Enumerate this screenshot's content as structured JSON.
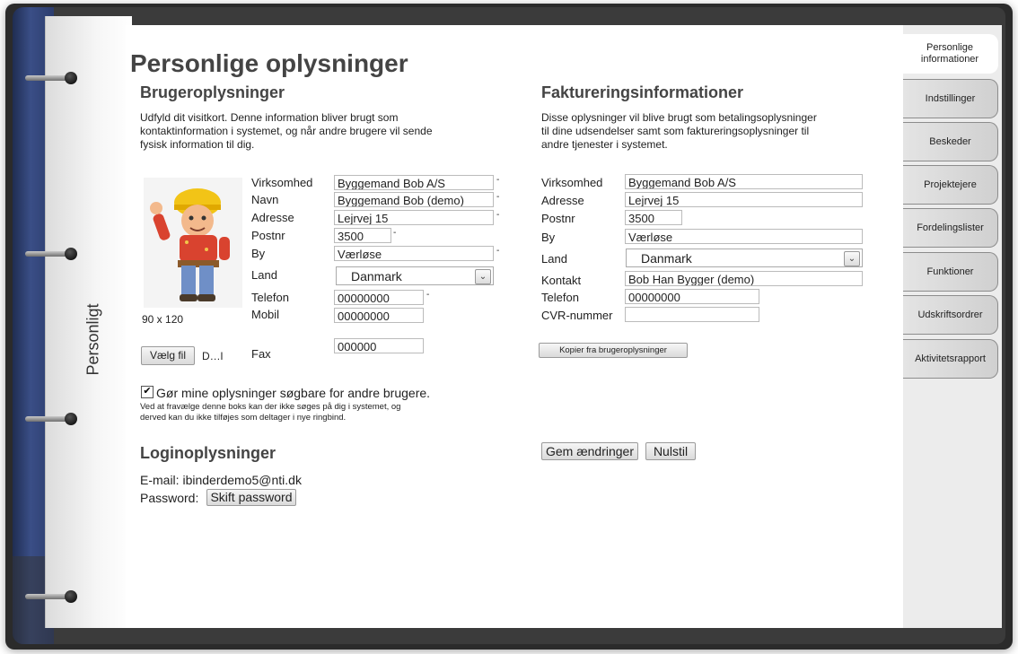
{
  "binder_tab_label": "Personligt",
  "page_title": "Personlige oplysninger",
  "user": {
    "heading": "Brugeroplysninger",
    "intro": "Udfyld dit visitkort. Denne information bliver brugt som kontaktinformation i systemet, og når andre brugere vil sende fysisk information til dig.",
    "intro_line1": "Udfyld dit visitkort. Denne information bliver brugt som",
    "intro_line2": "kontaktinformation i systemet, og når andre brugere vil sende",
    "intro_line3": "fysisk information til dig.",
    "avatar_size": "90 x 120",
    "file_button": "Vælg fil",
    "file_name": "D…l",
    "fields": {
      "company_label": "Virksomhed",
      "company_value": "Byggemand Bob A/S",
      "name_label": "Navn",
      "name_value": "Byggemand Bob (demo)",
      "address_label": "Adresse",
      "address_value": "Lejrvej 15",
      "zip_label": "Postnr",
      "zip_value": "3500",
      "city_label": "By",
      "city_value": "Værløse",
      "country_label": "Land",
      "country_value": "Danmark",
      "phone_label": "Telefon",
      "phone_value": "00000000",
      "mobile_label": "Mobil",
      "mobile_value": "00000000",
      "fax_label": "Fax",
      "fax_value": "000000"
    },
    "searchable_checkbox_checked": true,
    "searchable_label": "Gør mine oplysninger søgbare for andre brugere.",
    "searchable_note1": "Ved at fravælge denne boks kan der ikke søges på dig i systemet, og",
    "searchable_note2": "derved kan du ikke tilføjes som deltager i nye ringbind."
  },
  "login": {
    "heading": "Loginoplysninger",
    "email_label": "E-mail:",
    "email_value": "ibinderdemo5@nti.dk",
    "password_label": "Password:",
    "change_password_button": "Skift password"
  },
  "billing": {
    "heading": "Faktureringsinformationer",
    "intro_line1": "Disse oplysninger vil blive brugt som betalingsoplysninger",
    "intro_line2": "til dine udsendelser samt som faktureringsoplysninger til",
    "intro_line3": "andre tjenester i systemet.",
    "fields": {
      "company_label": "Virksomhed",
      "company_value": "Byggemand Bob A/S",
      "address_label": "Adresse",
      "address_value": "Lejrvej 15",
      "zip_label": "Postnr",
      "zip_value": "3500",
      "city_label": "By",
      "city_value": "Værløse",
      "country_label": "Land",
      "country_value": "Danmark",
      "contact_label": "Kontakt",
      "contact_value": "Bob Han Bygger (demo)",
      "phone_label": "Telefon",
      "phone_value": "00000000",
      "cvr_label": "CVR-nummer",
      "cvr_value": ""
    },
    "copy_button": "Kopier fra brugeroplysninger"
  },
  "actions": {
    "save_button": "Gem ændringer",
    "reset_button": "Nulstil"
  },
  "tabs": [
    {
      "label": "Personlige informationer",
      "active": true
    },
    {
      "label": "Indstillinger",
      "active": false
    },
    {
      "label": "Beskeder",
      "active": false
    },
    {
      "label": "Projektejere",
      "active": false
    },
    {
      "label": "Fordelingslister",
      "active": false
    },
    {
      "label": "Funktioner",
      "active": false
    },
    {
      "label": "Udskriftsordrer",
      "active": false
    },
    {
      "label": "Aktivitetsrapport",
      "active": false
    }
  ],
  "required_marker": "-"
}
